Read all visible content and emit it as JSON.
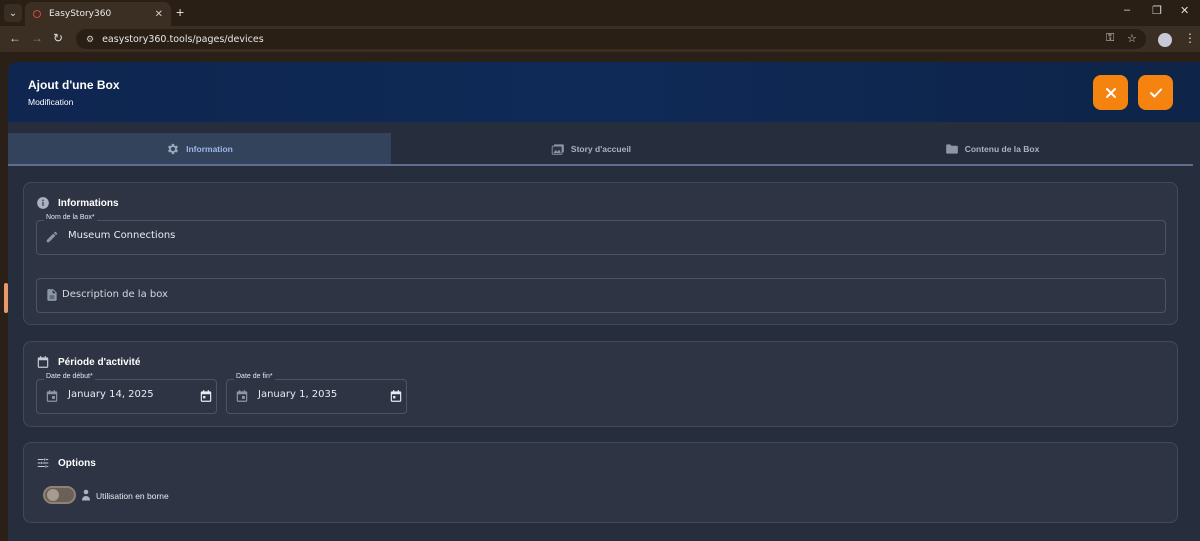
{
  "browser": {
    "tab_title": "EasyStory360",
    "url": "easystory360.tools/pages/devices"
  },
  "header": {
    "title": "Ajout d'une Box",
    "subtitle": "Modification"
  },
  "tabs": [
    {
      "label": "Information",
      "icon": "gear-icon",
      "active": true
    },
    {
      "label": "Story d'accueil",
      "icon": "image-stack-icon",
      "active": false
    },
    {
      "label": "Contenu de la Box",
      "icon": "folder-icon",
      "active": false
    }
  ],
  "informations": {
    "title": "Informations",
    "name_label": "Nom de la Box*",
    "name_value": "Museum Connections",
    "description_placeholder": "Description de la box"
  },
  "periode": {
    "title": "Période d'activité",
    "start_label": "Date de début*",
    "start_value": "January 14, 2025",
    "end_label": "Date de fin*",
    "end_value": "January 1, 2035"
  },
  "options": {
    "title": "Options",
    "kiosk_label": "Utilisation en borne",
    "kiosk_enabled": false
  },
  "colors": {
    "accent": "#f5830f",
    "header": "#0f2a57",
    "active_tab_text": "#9bb6e8"
  }
}
